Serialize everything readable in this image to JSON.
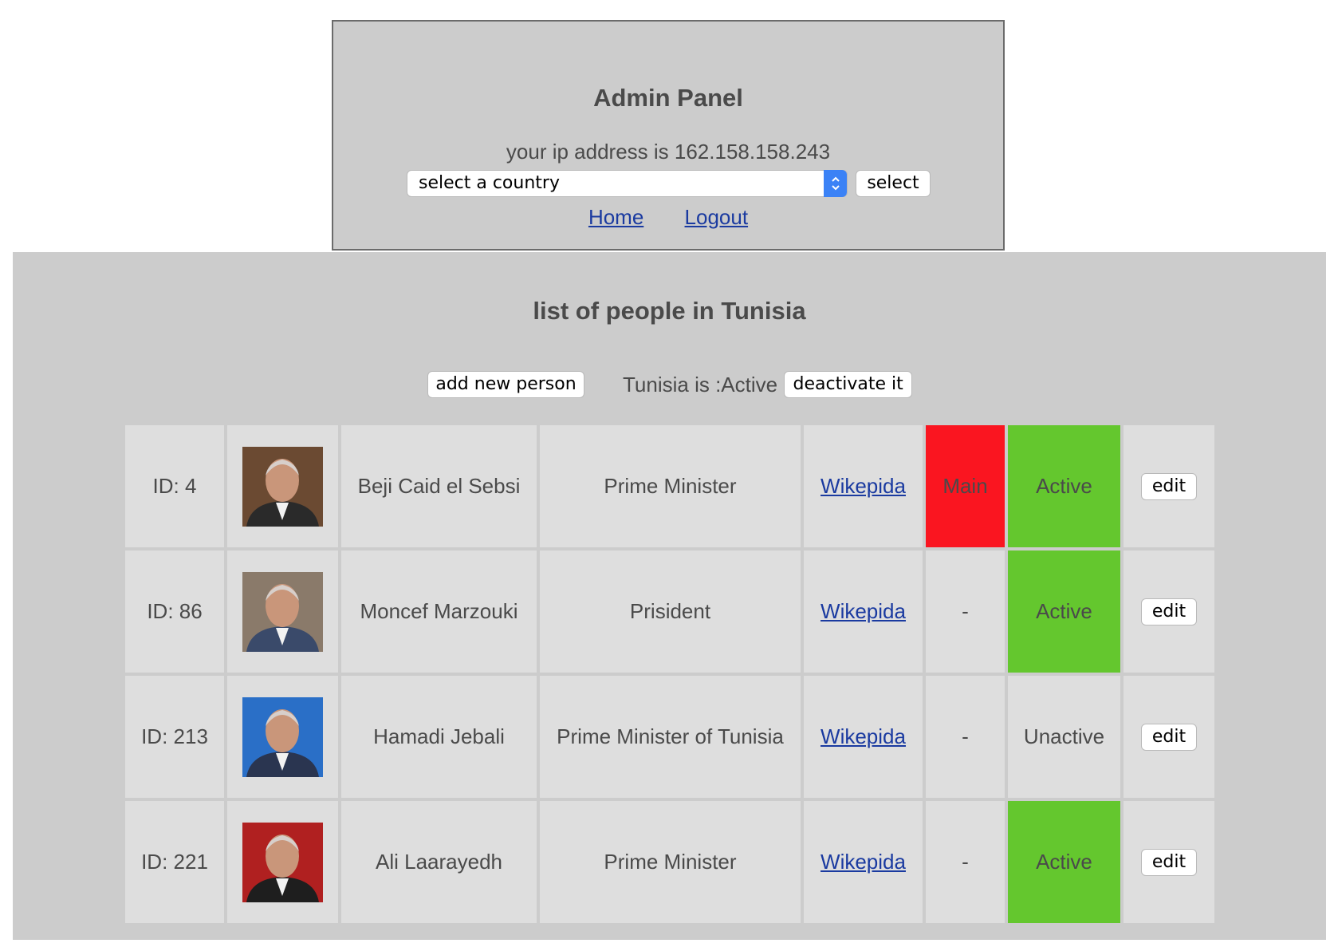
{
  "admin": {
    "title": "Admin Panel",
    "ip_text": "your ip address is 162.158.158.243",
    "country_select": {
      "selected": "select a country"
    },
    "select_button": "select",
    "links": {
      "home": "Home",
      "logout": "Logout"
    }
  },
  "people_section": {
    "title": "list of people in Tunisia",
    "add_button": "add new person",
    "country_status": "Tunisia is :Active",
    "deactivate_button": "deactivate it"
  },
  "colors": {
    "main_red": "#fa1520",
    "active_green": "#64c72e",
    "cell_grey": "#dedede",
    "panel_grey": "#cccccc",
    "link_blue": "#1a3aa0",
    "select_blue": "#3b82f6"
  },
  "people": [
    {
      "id": "ID: 4",
      "photo_icon": "portrait-photo",
      "name": "Beji Caid el Sebsi",
      "role": "Prime Minister",
      "link": "Wikepida",
      "main": "Main",
      "is_main": true,
      "status": "Active",
      "is_active": true,
      "edit": "edit"
    },
    {
      "id": "ID: 86",
      "photo_icon": "portrait-photo",
      "name": "Moncef Marzouki",
      "role": "Prisident",
      "link": "Wikepida",
      "main": "-",
      "is_main": false,
      "status": "Active",
      "is_active": true,
      "edit": "edit"
    },
    {
      "id": "ID: 213",
      "photo_icon": "portrait-photo",
      "name": "Hamadi Jebali",
      "role": "Prime Minister of Tunisia",
      "link": "Wikepida",
      "main": "-",
      "is_main": false,
      "status": "Unactive",
      "is_active": false,
      "edit": "edit"
    },
    {
      "id": "ID: 221",
      "photo_icon": "portrait-photo",
      "name": "Ali Laarayedh",
      "role": "Prime Minister",
      "link": "Wikepida",
      "main": "-",
      "is_main": false,
      "status": "Active",
      "is_active": true,
      "edit": "edit"
    }
  ]
}
